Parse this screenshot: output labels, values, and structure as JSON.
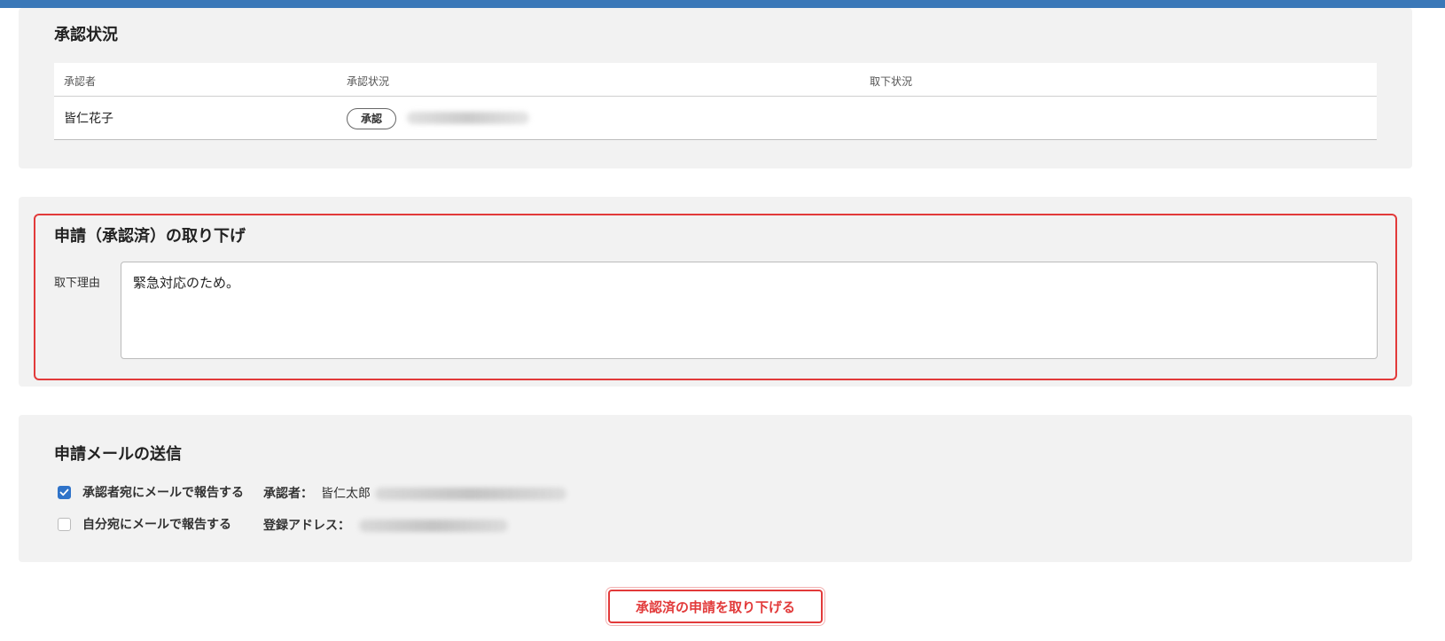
{
  "approval": {
    "title": "承認状況",
    "columns": [
      "承認者",
      "承認状況",
      "取下状況"
    ],
    "rows": [
      {
        "approver": "皆仁花子",
        "status_badge": "承認"
      }
    ]
  },
  "withdraw": {
    "title": "申請（承認済）の取り下げ",
    "reason_label": "取下理由",
    "reason_value": "緊急対応のため。"
  },
  "mail": {
    "title": "申請メールの送信",
    "options": [
      {
        "label": "承認者宛にメールで報告する",
        "checked": true,
        "meta_label": "承認者：",
        "meta_value": "皆仁太郎"
      },
      {
        "label": "自分宛にメールで報告する",
        "checked": false,
        "meta_label": "登録アドレス："
      }
    ]
  },
  "actions": {
    "withdraw_button": "承認済の申請を取り下げる"
  },
  "colors": {
    "header_bar": "#3a78b8",
    "highlight": "#e23a3a",
    "checkbox_checked": "#2f73c9"
  }
}
